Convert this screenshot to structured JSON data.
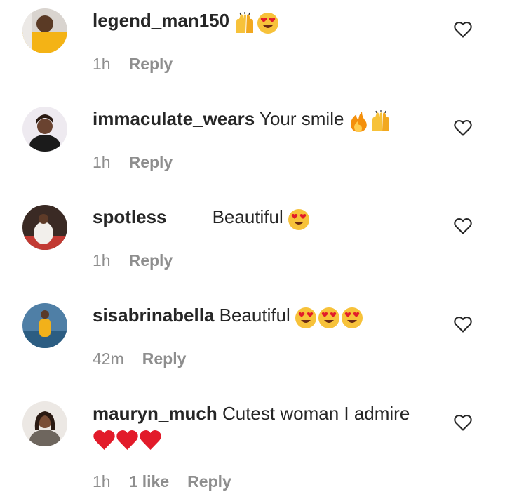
{
  "comments": [
    {
      "username": "legend_man150",
      "text": "",
      "emojis": [
        "raised-hands-emoji",
        "heart-eyes-emoji"
      ],
      "time": "1h",
      "reply": "Reply"
    },
    {
      "username": "immaculate_wears",
      "text": "Your smile",
      "emojis": [
        "fire-emoji",
        "raised-hands-emoji"
      ],
      "time": "1h",
      "reply": "Reply"
    },
    {
      "username": "spotless____",
      "text": "Beautiful",
      "emojis": [
        "heart-eyes-emoji"
      ],
      "time": "1h",
      "reply": "Reply"
    },
    {
      "username": "sisabrinabella",
      "text": "Beautiful",
      "emojis": [
        "heart-eyes-emoji",
        "heart-eyes-emoji",
        "heart-eyes-emoji"
      ],
      "time": "42m",
      "reply": "Reply"
    },
    {
      "username": "mauryn_much",
      "text": "Cutest woman I admire",
      "emojis": [
        "red-heart-emoji",
        "red-heart-emoji",
        "red-heart-emoji"
      ],
      "time": "1h",
      "likes": "1 like",
      "reply": "Reply"
    }
  ],
  "icons": {
    "like": "heart-outline-icon"
  },
  "colors": {
    "text": "#262626",
    "meta": "#8e8e8e",
    "emoji_yellow": "#f7c23a",
    "heart_red": "#e21b2a",
    "fire_orange": "#f4900c"
  }
}
